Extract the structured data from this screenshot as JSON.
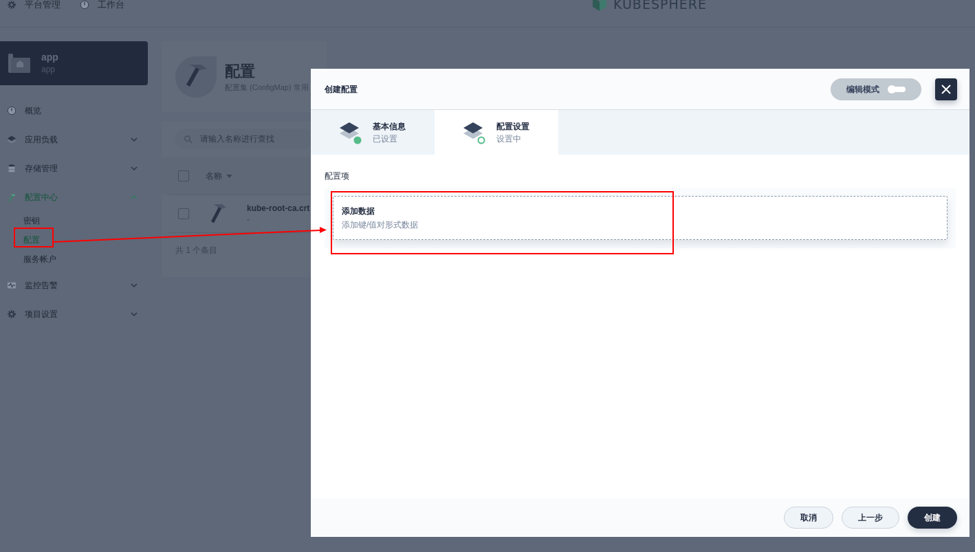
{
  "top_nav": [
    {
      "label": "平台管理"
    },
    {
      "label": "工作台"
    }
  ],
  "logo": {
    "text": "KUBESPHERE"
  },
  "workspace": {
    "name": "app",
    "subtitle": "app"
  },
  "sidebar": {
    "items": [
      {
        "label": "概览",
        "selected": false
      },
      {
        "label": "应用负载",
        "selected": false,
        "expanded": false
      },
      {
        "label": "存储管理",
        "selected": false,
        "expanded": false
      },
      {
        "label": "配置中心",
        "selected": true,
        "expanded": true,
        "children": [
          {
            "label": "密钥",
            "selected": false
          },
          {
            "label": "配置",
            "selected": true
          },
          {
            "label": "服务帐户",
            "selected": false
          }
        ]
      },
      {
        "label": "监控告警",
        "selected": false,
        "expanded": false
      },
      {
        "label": "项目设置",
        "selected": false,
        "expanded": false
      }
    ]
  },
  "page_header": {
    "title": "配置",
    "description": "配置集 (ConfigMap) 常用"
  },
  "list": {
    "search": {
      "placeholder": "请输入名称进行查找"
    },
    "all_checked": false,
    "columns": [
      "名称"
    ],
    "rows": [
      {
        "name": "kube-root-ca.crt",
        "description": "-",
        "checked": false
      }
    ],
    "total": "共 1 个条目"
  },
  "modal": {
    "title": "创建配置",
    "edit_mode": {
      "label": "编辑模式",
      "on": false
    },
    "steps": [
      {
        "title": "基本信息",
        "status": "已设置",
        "done": true,
        "selected": false
      },
      {
        "title": "配置设置",
        "status": "设置中",
        "done": false,
        "selected": true
      }
    ],
    "section_label": "配置项",
    "add_data": {
      "title": "添加数据",
      "description": "添加键/值对形式数据"
    },
    "buttons": [
      {
        "label": "取消",
        "kind": "secondary"
      },
      {
        "label": "上一步",
        "kind": "secondary"
      },
      {
        "label": "创建",
        "kind": "primary"
      }
    ]
  }
}
